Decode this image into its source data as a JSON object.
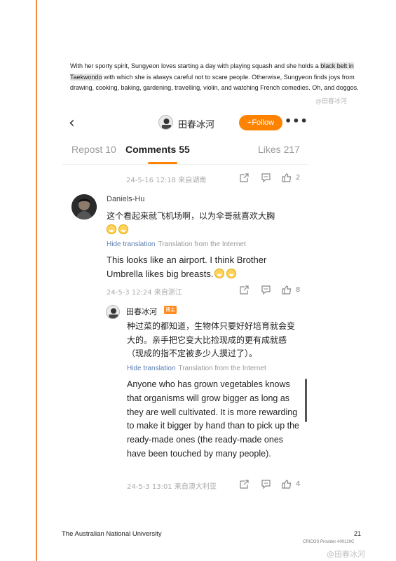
{
  "document": {
    "intro_before": "With her sporty spirit, Sungyeon loves starting a day with playing squash and she holds a ",
    "intro_highlight": "black belt in Taekwondo",
    "intro_after": " with which she is always careful not to scare people. Otherwise, Sungyeon finds joys from drawing, cooking, baking, gardening, travelling, violin, and watching French comedies. Oh, and doggos.",
    "footer_left": "The Australian National University",
    "footer_page": "21",
    "footer_cricos": "CRICOS Provider #00120C"
  },
  "watermarks": {
    "top": "@田春冰河",
    "bottom": "@田春冰河"
  },
  "app": {
    "back_icon": "chevron-left",
    "title": "田春冰河",
    "follow_label": "+Follow",
    "more_icon": "•••",
    "tabs": {
      "repost": "Repost 10",
      "comments": "Comments 55",
      "likes": "Likes 217"
    },
    "first_row": {
      "meta": "24-5-16 12:18  来自湖南",
      "like_count": "2"
    },
    "comment1": {
      "author": "Daniels-Hu",
      "text_cn": "这个看起来就飞机场啊，以为伞哥就喜欢大胸",
      "hide_translation": "Hide translation",
      "translation_source": "Translation from the Internet",
      "text_en": "This looks like an airport. I think Brother Umbrella likes big breasts.",
      "meta": "24-5-3 12:24  来自浙江",
      "like_count": "8"
    },
    "reply": {
      "author": "田春冰河",
      "badge": "博主",
      "text_cn": "种过菜的都知道，生物体只要好好培育就会变大的。亲手把它变大比捡现成的更有成就感（现成的指不定被多少人摸过了）。",
      "hide_translation": "Hide translation",
      "translation_source": "Translation from the Internet",
      "text_en": "Anyone who has grown vegetables knows that organisms will grow bigger as long as they are well cultivated. It is more rewarding to make it bigger by hand than to pick up the ready-made ones (the ready-made ones have been touched by many people).",
      "meta": "24-5-3 13:01  来自澳大利亚",
      "like_count": "4"
    }
  }
}
